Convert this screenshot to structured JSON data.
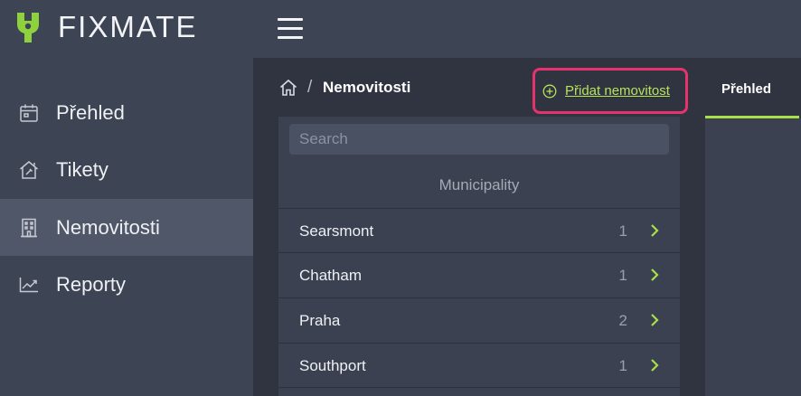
{
  "app": {
    "brand": "FIXMATE",
    "accent_color": "#a8e04a",
    "highlight_color": "#e6336e"
  },
  "sidebar": {
    "items": [
      {
        "label": "Přehled",
        "icon": "calendar-icon",
        "active": false
      },
      {
        "label": "Tikety",
        "icon": "house-tools-icon",
        "active": false
      },
      {
        "label": "Nemovitosti",
        "icon": "building-icon",
        "active": true
      },
      {
        "label": "Reporty",
        "icon": "chart-line-icon",
        "active": false
      }
    ]
  },
  "breadcrumb": {
    "home_icon": "home-icon",
    "separator": "/",
    "current": "Nemovitosti"
  },
  "actions": {
    "add_label": "Přidat nemovitost",
    "add_icon": "plus-circle-icon"
  },
  "tabs": [
    {
      "label": "Přehled",
      "active": true
    }
  ],
  "list": {
    "search_placeholder": "Search",
    "header": "Municipality",
    "rows": [
      {
        "name": "Searsmont",
        "count": "1"
      },
      {
        "name": "Chatham",
        "count": "1"
      },
      {
        "name": "Praha",
        "count": "2"
      },
      {
        "name": "Southport",
        "count": "1"
      }
    ]
  }
}
